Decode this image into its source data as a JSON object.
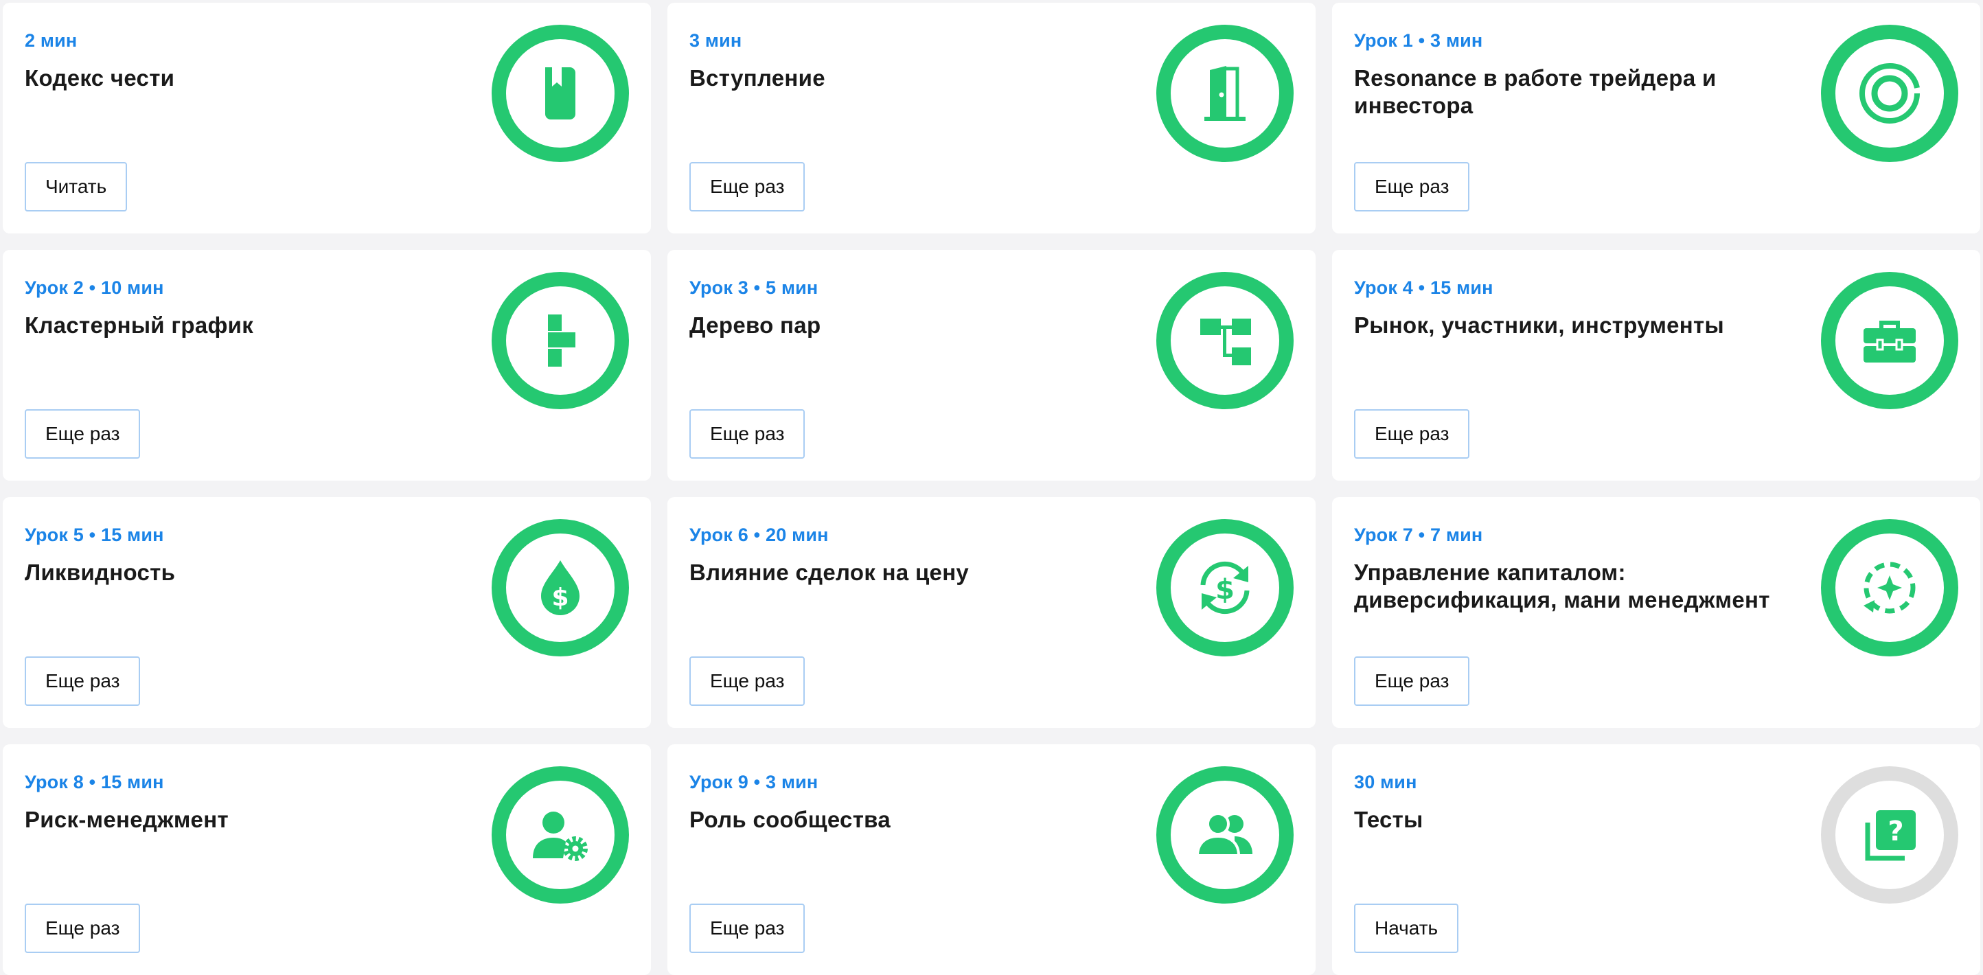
{
  "colors": {
    "accent_green": "#25c871",
    "meta_blue": "#1b84e7",
    "inactive_ring": "#dedede"
  },
  "cards": [
    {
      "meta": "2 мин",
      "title": "Кодекс чести",
      "button": "Читать",
      "icon": "book-bookmark-icon"
    },
    {
      "meta": "3 мин",
      "title": "Вступление",
      "button": "Еще раз",
      "icon": "door-icon"
    },
    {
      "meta": "Урок 1 • 3 мин",
      "title": "Resonance в работе трейдера и инвестора",
      "button": "Еще раз",
      "icon": "target-rings-icon"
    },
    {
      "meta": "Урок 2 • 10 мин",
      "title": "Кластерный график",
      "button": "Еще раз",
      "icon": "cluster-chart-icon"
    },
    {
      "meta": "Урок 3 • 5 мин",
      "title": "Дерево пар",
      "button": "Еще раз",
      "icon": "tree-icon"
    },
    {
      "meta": "Урок 4 • 15 мин",
      "title": "Рынок, участники, инструменты",
      "button": "Еще раз",
      "icon": "toolbox-icon"
    },
    {
      "meta": "Урок 5 • 15 мин",
      "title": "Ликвидность",
      "button": "Еще раз",
      "icon": "money-drop-icon"
    },
    {
      "meta": "Урок 6 • 20 мин",
      "title": "Влияние сделок на цену",
      "button": "Еще раз",
      "icon": "dollar-cycle-icon"
    },
    {
      "meta": "Урок 7 • 7 мин",
      "title": "Управление капиталом: диверсификация, мани менеджмент",
      "button": "Еще раз",
      "icon": "sparkle-cycle-icon"
    },
    {
      "meta": "Урок 8 • 15 мин",
      "title": "Риск-менеджмент",
      "button": "Еще раз",
      "icon": "user-gear-icon"
    },
    {
      "meta": "Урок 9 • 3 мин",
      "title": "Роль сообщества",
      "button": "Еще раз",
      "icon": "users-icon"
    },
    {
      "meta": "30 мин",
      "title": "Тесты",
      "button": "Начать",
      "icon": "quiz-question-icon",
      "inactive": true
    }
  ]
}
